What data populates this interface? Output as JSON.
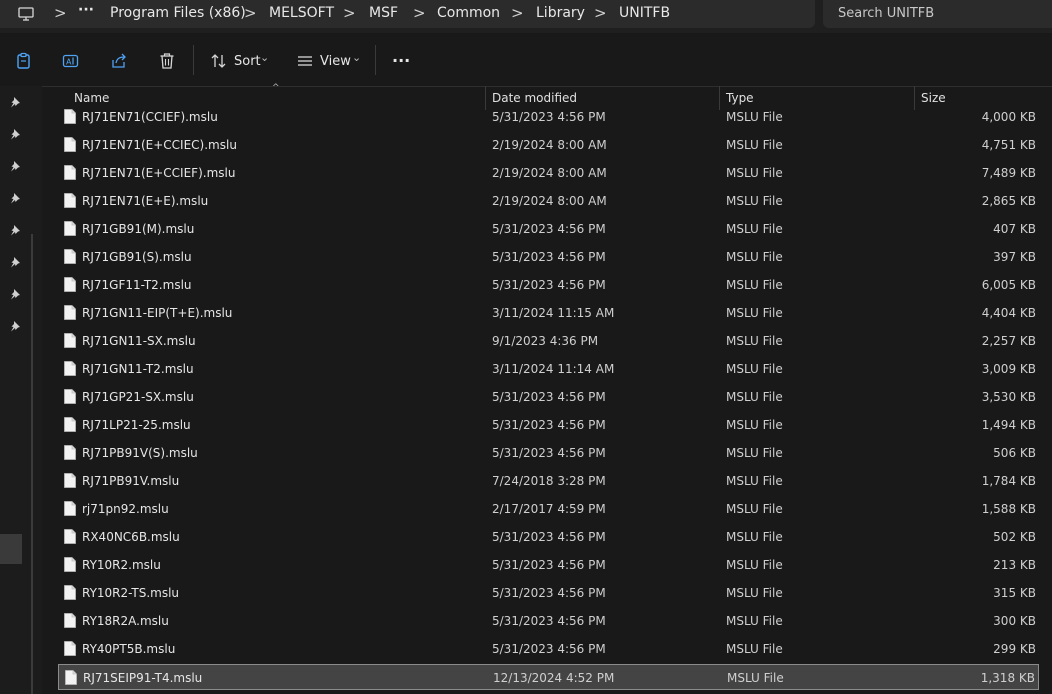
{
  "address_bar": {
    "more": "···",
    "crumbs": [
      "Program Files (x86)",
      "MELSOFT",
      "MSF",
      "Common",
      "Library",
      "UNITFB"
    ],
    "separator": ">"
  },
  "search": {
    "placeholder": "Search UNITFB"
  },
  "toolbar": {
    "sort_label": "Sort",
    "view_label": "View",
    "more_label": "···",
    "chevron": "⌄"
  },
  "columns": {
    "name": "Name",
    "date": "Date modified",
    "type": "Type",
    "size": "Size",
    "sort_caret": "^"
  },
  "files": [
    {
      "name": "RJ71EN71(CCIEF).mslu",
      "date": "5/31/2023 4:56 PM",
      "type": "MSLU File",
      "size": "4,000 KB"
    },
    {
      "name": "RJ71EN71(E+CCIEC).mslu",
      "date": "2/19/2024 8:00 AM",
      "type": "MSLU File",
      "size": "4,751 KB"
    },
    {
      "name": "RJ71EN71(E+CCIEF).mslu",
      "date": "2/19/2024 8:00 AM",
      "type": "MSLU File",
      "size": "7,489 KB"
    },
    {
      "name": "RJ71EN71(E+E).mslu",
      "date": "2/19/2024 8:00 AM",
      "type": "MSLU File",
      "size": "2,865 KB"
    },
    {
      "name": "RJ71GB91(M).mslu",
      "date": "5/31/2023 4:56 PM",
      "type": "MSLU File",
      "size": "407 KB"
    },
    {
      "name": "RJ71GB91(S).mslu",
      "date": "5/31/2023 4:56 PM",
      "type": "MSLU File",
      "size": "397 KB"
    },
    {
      "name": "RJ71GF11-T2.mslu",
      "date": "5/31/2023 4:56 PM",
      "type": "MSLU File",
      "size": "6,005 KB"
    },
    {
      "name": "RJ71GN11-EIP(T+E).mslu",
      "date": "3/11/2024 11:15 AM",
      "type": "MSLU File",
      "size": "4,404 KB"
    },
    {
      "name": "RJ71GN11-SX.mslu",
      "date": "9/1/2023 4:36 PM",
      "type": "MSLU File",
      "size": "2,257 KB"
    },
    {
      "name": "RJ71GN11-T2.mslu",
      "date": "3/11/2024 11:14 AM",
      "type": "MSLU File",
      "size": "3,009 KB"
    },
    {
      "name": "RJ71GP21-SX.mslu",
      "date": "5/31/2023 4:56 PM",
      "type": "MSLU File",
      "size": "3,530 KB"
    },
    {
      "name": "RJ71LP21-25.mslu",
      "date": "5/31/2023 4:56 PM",
      "type": "MSLU File",
      "size": "1,494 KB"
    },
    {
      "name": "RJ71PB91V(S).mslu",
      "date": "5/31/2023 4:56 PM",
      "type": "MSLU File",
      "size": "506 KB"
    },
    {
      "name": "RJ71PB91V.mslu",
      "date": "7/24/2018 3:28 PM",
      "type": "MSLU File",
      "size": "1,784 KB"
    },
    {
      "name": "rj71pn92.mslu",
      "date": "2/17/2017 4:59 PM",
      "type": "MSLU File",
      "size": "1,588 KB"
    },
    {
      "name": "RX40NC6B.mslu",
      "date": "5/31/2023 4:56 PM",
      "type": "MSLU File",
      "size": "502 KB"
    },
    {
      "name": "RY10R2.mslu",
      "date": "5/31/2023 4:56 PM",
      "type": "MSLU File",
      "size": "213 KB"
    },
    {
      "name": "RY10R2-TS.mslu",
      "date": "5/31/2023 4:56 PM",
      "type": "MSLU File",
      "size": "315 KB"
    },
    {
      "name": "RY18R2A.mslu",
      "date": "5/31/2023 4:56 PM",
      "type": "MSLU File",
      "size": "300 KB"
    },
    {
      "name": "RY40PT5B.mslu",
      "date": "5/31/2023 4:56 PM",
      "type": "MSLU File",
      "size": "299 KB"
    },
    {
      "name": "RJ71SEIP91-T4.mslu",
      "date": "12/13/2024 4:52 PM",
      "type": "MSLU File",
      "size": "1,318 KB",
      "selected": true
    }
  ]
}
